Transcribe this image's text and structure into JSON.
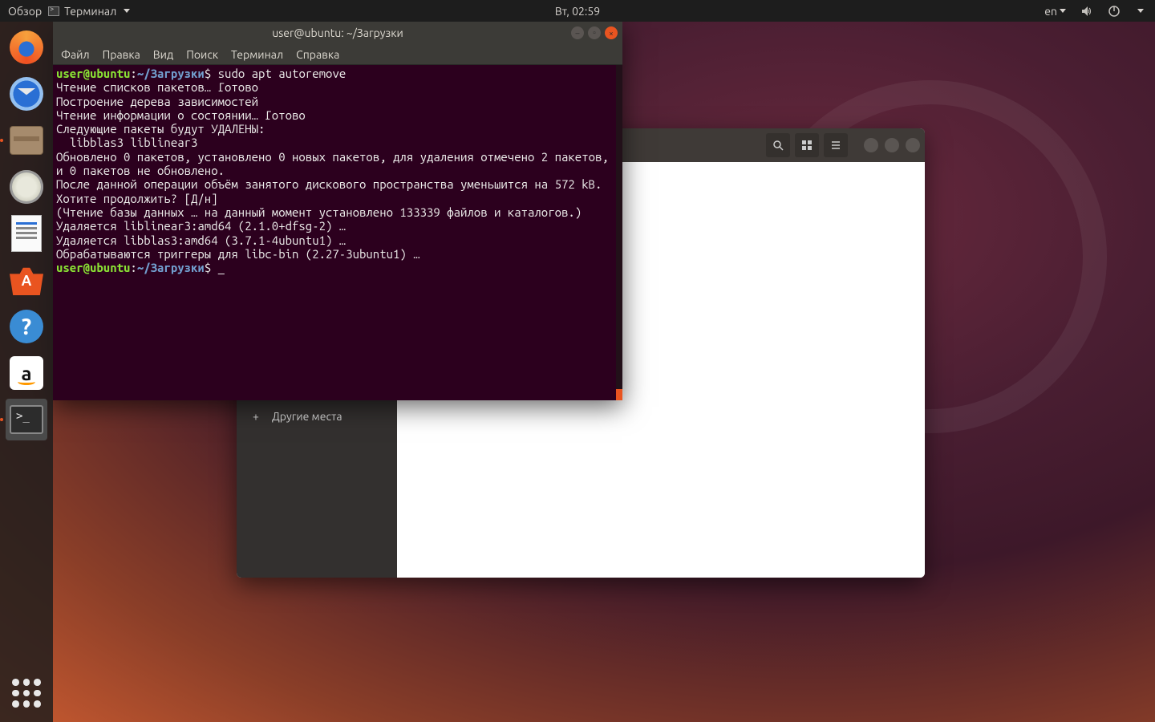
{
  "topbar": {
    "activities": "Обзор",
    "app_name": "Терминал",
    "clock": "Вт, 02:59",
    "lang": "en"
  },
  "dock": {
    "firefox": "Firefox",
    "thunderbird": "Thunderbird",
    "files": "Файлы",
    "rhythmbox": "Rhythmbox",
    "writer": "LibreOffice Writer",
    "software": "Ubuntu Software",
    "help": "Справка",
    "amazon": "Amazon",
    "terminal": "Терминал",
    "apps": "Показать приложения"
  },
  "files": {
    "sidebar": {
      "other_places": "Другие места"
    }
  },
  "terminal": {
    "title": "user@ubuntu: ~/Загрузки",
    "menu": {
      "file": "Файл",
      "edit": "Правка",
      "view": "Вид",
      "search": "Поиск",
      "terminal": "Терминал",
      "help": "Справка"
    },
    "prompt_user": "user@ubuntu",
    "prompt_sep": ":",
    "prompt_path": "~/Загрузки",
    "prompt_sym": "$",
    "cmd1": "sudo apt autoremove",
    "lines": {
      "l1": "Чтение списков пакетов… Готово",
      "l2": "Построение дерева зависимостей",
      "l3": "Чтение информации о состоянии… Готово",
      "l4": "Следующие пакеты будут УДАЛЕНЫ:",
      "l5": "  libblas3 liblinear3",
      "l6": "Обновлено 0 пакетов, установлено 0 новых пакетов, для удаления отмечено 2 пакетов, и 0 пакетов не обновлено.",
      "l7": "После данной операции объём занятого дискового пространства уменьшится на 572 kB.",
      "l8": "Хотите продолжить? [Д/н]",
      "l9": "(Чтение базы данных … на данный момент установлено 133339 файлов и каталогов.)",
      "l10": "Удаляется liblinear3:amd64 (2.1.0+dfsg-2) …",
      "l11": "Удаляется libblas3:amd64 (3.7.1-4ubuntu1) …",
      "l12": "Обрабатываются триггеры для libc-bin (2.27-3ubuntu1) …"
    },
    "cursor": "_"
  }
}
